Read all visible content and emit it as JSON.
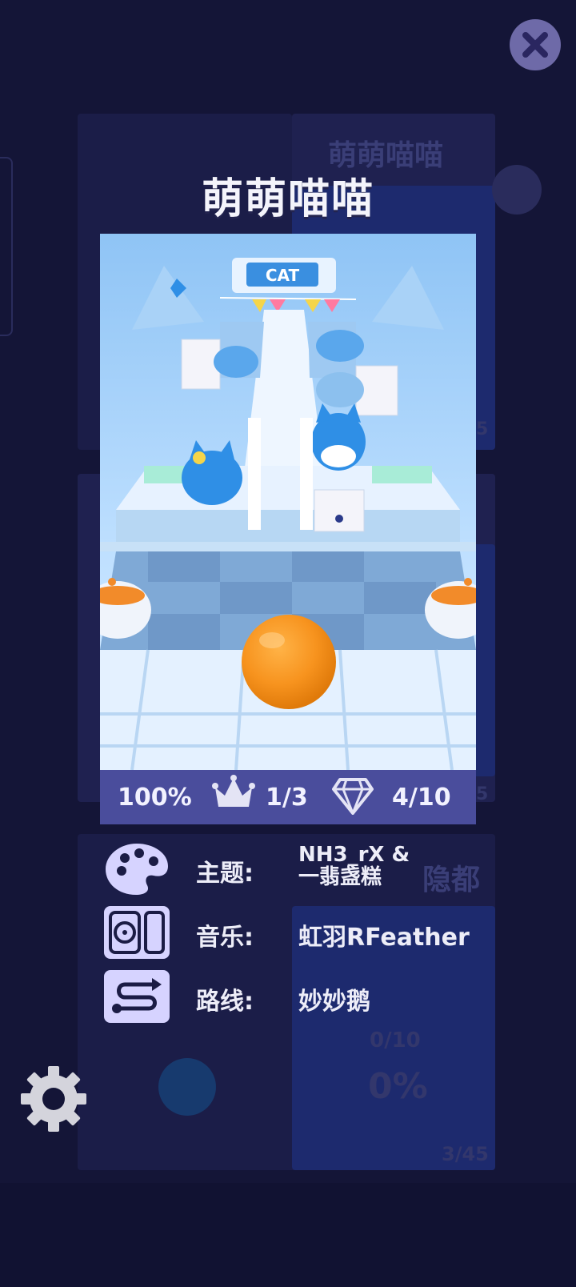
{
  "background": {
    "ghost_title": "萌萌喵喵",
    "ghost_city": "隐都",
    "ghost_gems": "0/10",
    "ghost_percent": "0%",
    "ghost_page": "3/45",
    "ghost_num1": "5",
    "ghost_num2": "5"
  },
  "level": {
    "title": "萌萌喵喵",
    "sign_text": "CAT"
  },
  "stats": {
    "percent": "100%",
    "crowns": "1/3",
    "gems": "4/10"
  },
  "info": {
    "theme_label": "主题:",
    "theme_value_line1": "NH3_rX &",
    "theme_value_line2": "一翡盏糕",
    "music_label": "音乐:",
    "music_value": "虹羽RFeather",
    "route_label": "路线:",
    "route_value": "妙妙鹅"
  },
  "icons": {
    "close": "close-icon",
    "crown": "crown-icon",
    "gem": "gem-icon",
    "theme": "palette-icon",
    "music": "music-player-icon",
    "route": "route-icon",
    "settings": "gear-icon"
  },
  "colors": {
    "background": "#141537",
    "stats_bar": "#4a4d9c",
    "icon_tile": "#d6d3ff",
    "close_button": "#6e6aa8",
    "ball": "#f7931e"
  }
}
